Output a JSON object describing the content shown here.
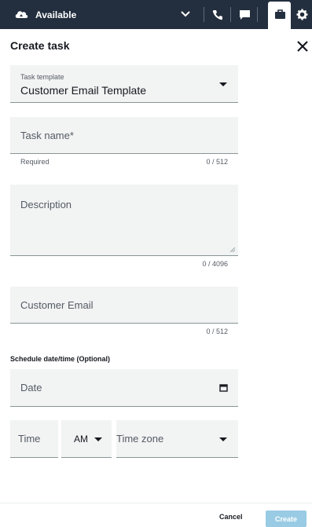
{
  "topbar": {
    "status_label": "Available",
    "icons": [
      "cloud-status-icon",
      "chevron-down-icon",
      "phone-icon",
      "chat-icon",
      "briefcase-icon",
      "gear-icon"
    ],
    "bg_color": "#232f3e"
  },
  "header": {
    "title": "Create task",
    "close_icon": "close-icon"
  },
  "form": {
    "task_template": {
      "label": "Task template",
      "value": "Customer Email Template"
    },
    "task_name": {
      "placeholder": "Task name*",
      "helper": "Required",
      "counter": "0 / 512"
    },
    "description": {
      "placeholder": "Description",
      "counter": "0 / 4096"
    },
    "customer_email": {
      "placeholder": "Customer Email",
      "counter": "0 / 512"
    },
    "schedule": {
      "section_label": "Schedule date/time (Optional)",
      "date_placeholder": "Date",
      "time_placeholder": "Time",
      "ampm_value": "AM",
      "timezone_placeholder": "Time zone"
    }
  },
  "footer": {
    "cancel_label": "Cancel",
    "create_label": "Create",
    "create_color": "#99cbe4"
  }
}
